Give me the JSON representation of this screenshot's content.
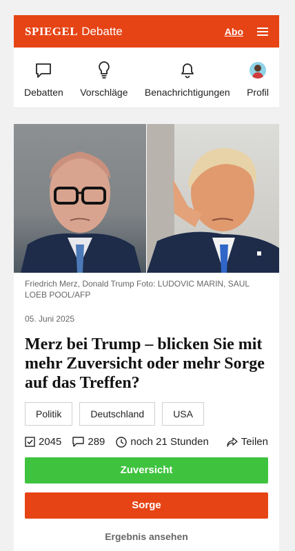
{
  "header": {
    "brand": "SPIEGEL",
    "section": "Debatte",
    "abo_label": "Abo"
  },
  "nav": {
    "items": [
      {
        "label": "Debatten",
        "icon": "speech-bubble-icon"
      },
      {
        "label": "Vorschläge",
        "icon": "lightbulb-icon"
      },
      {
        "label": "Benachrichtigungen",
        "icon": "bell-icon"
      },
      {
        "label": "Profil",
        "icon": "avatar"
      }
    ]
  },
  "article": {
    "caption": "Friedrich Merz, Donald Trump Foto: LUDOVIC MARIN, SAUL LOEB POOL/AFP",
    "date": "05. Juni 2025",
    "headline": "Merz bei Trump – blicken Sie mit mehr Zuversicht oder mehr Sorge auf das Treffen?",
    "tags": [
      "Politik",
      "Deutschland",
      "USA"
    ],
    "stats": {
      "votes": "2045",
      "comments": "289",
      "time_left": "noch 21 Stunden",
      "share_label": "Teilen"
    },
    "buttons": {
      "option_a": "Zuversicht",
      "option_b": "Sorge",
      "result": "Ergebnis ansehen"
    }
  },
  "colors": {
    "brand": "#e64415",
    "green": "#3fc33f"
  }
}
